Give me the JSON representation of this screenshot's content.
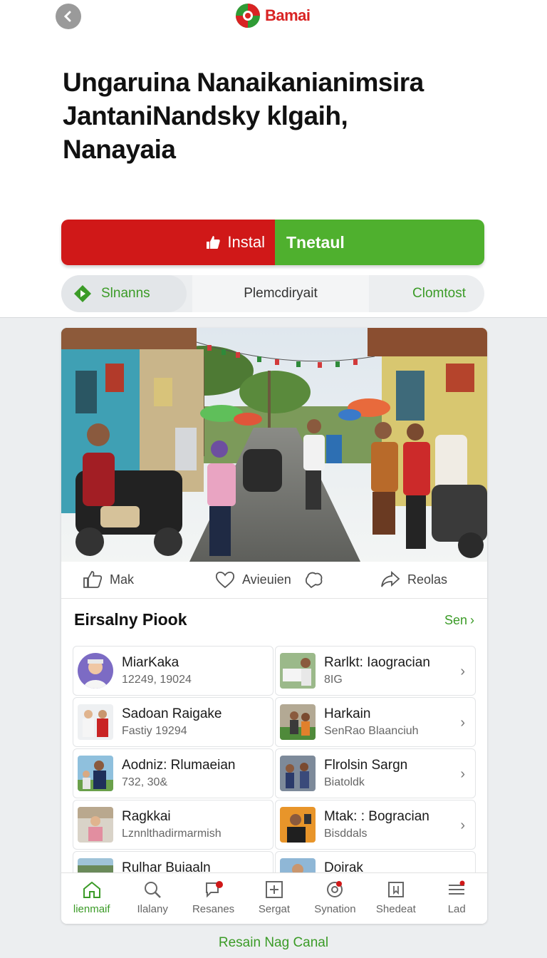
{
  "header": {
    "brand": "Bamai",
    "headline_lines": [
      "Ungaruina Nanaikanianimsira",
      "JantaniNandsky klgaih,",
      "Nanayaia"
    ]
  },
  "cta": {
    "install_label": "Instal",
    "second_label": "Tnetaul"
  },
  "segments": {
    "first": "Slnanns",
    "middle": "Plemcdiryait",
    "last": "Clomtost"
  },
  "post_actions": {
    "like": "Mak",
    "favorite": "Avieuien",
    "share": "Reolas"
  },
  "section": {
    "title": "Eirsalny Piook",
    "see_all": "Sen"
  },
  "people": [
    {
      "name": "MiarKaka",
      "sub": "12249, 19024"
    },
    {
      "name": "Rarlkt: Iaogracian",
      "sub": "8IG"
    },
    {
      "name": "Sadoan Raigake",
      "sub": "Fastiy 19294"
    },
    {
      "name": "Harkain",
      "sub": "SenRao Blaanciuh"
    },
    {
      "name": "Aodniz: Rlumaeian",
      "sub": "732, 30&"
    },
    {
      "name": "Flrolsin Sargn",
      "sub": "Biatoldk"
    },
    {
      "name": "Ragkkai",
      "sub": "Lznnlthadirmarmish"
    },
    {
      "name": "Mtak: : Bogracian",
      "sub": "Bisddals"
    },
    {
      "name": "Rulhar Buiaaln",
      "sub": ""
    },
    {
      "name": "Doirak",
      "sub": ""
    }
  ],
  "tabs": [
    {
      "label": "lienmaif",
      "icon": "home-icon"
    },
    {
      "label": "Ilalany",
      "icon": "search-icon"
    },
    {
      "label": "Resanes",
      "icon": "chat-icon"
    },
    {
      "label": "Sergat",
      "icon": "add-box-icon"
    },
    {
      "label": "Synation",
      "icon": "target-icon"
    },
    {
      "label": "Shedeat",
      "icon": "bookmark-icon"
    },
    {
      "label": "Lad",
      "icon": "menu-icon"
    }
  ],
  "footer": {
    "link": "Resain Nag Canal"
  },
  "colors": {
    "brand_red": "#d01818",
    "brand_green": "#4fb02e",
    "accent_green": "#3b9b27"
  }
}
